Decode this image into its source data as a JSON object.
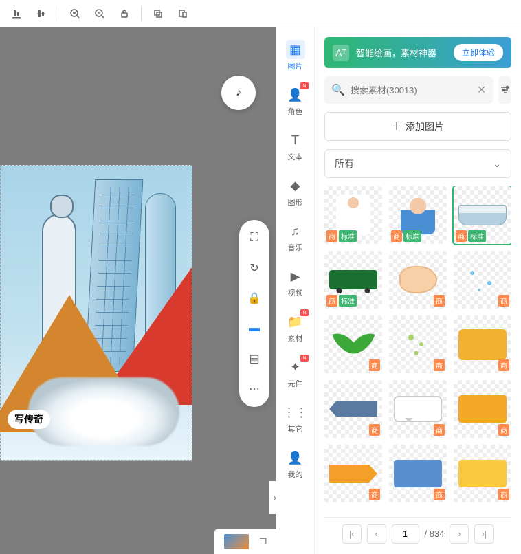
{
  "toolbar": {
    "items": [
      "align-bottom",
      "align-center-v",
      "zoom-in",
      "zoom-out",
      "unlock",
      "copy",
      "paste"
    ]
  },
  "canvas": {
    "text_label": "写传奇"
  },
  "sidebar": {
    "items": [
      {
        "key": "image",
        "label": "图片",
        "active": true,
        "badge": false
      },
      {
        "key": "role",
        "label": "角色",
        "active": false,
        "badge": true
      },
      {
        "key": "text",
        "label": "文本",
        "active": false,
        "badge": false
      },
      {
        "key": "shape",
        "label": "图形",
        "active": false,
        "badge": false
      },
      {
        "key": "music",
        "label": "音乐",
        "active": false,
        "badge": false
      },
      {
        "key": "video",
        "label": "视频",
        "active": false,
        "badge": false
      },
      {
        "key": "assets",
        "label": "素材",
        "active": false,
        "badge": true
      },
      {
        "key": "component",
        "label": "元件",
        "active": false,
        "badge": true
      },
      {
        "key": "other",
        "label": "其它",
        "active": false,
        "badge": false
      },
      {
        "key": "mine",
        "label": "我的",
        "active": false,
        "badge": false
      }
    ]
  },
  "panel": {
    "promo_text": "智能绘画，素材神器",
    "promo_btn": "立即体验",
    "search_placeholder": "搜索素材(30013)",
    "add_label": "添加图片",
    "dropdown_value": "所有",
    "tags": {
      "shop": "商",
      "standard": "标准"
    },
    "assets": [
      {
        "kind": "doctor",
        "shop": true,
        "std": true,
        "tag_side": "left",
        "selected": false
      },
      {
        "kind": "person",
        "shop": true,
        "std": true,
        "tag_side": "left",
        "selected": false
      },
      {
        "kind": "ship",
        "shop": true,
        "std": true,
        "tag_side": "left",
        "selected": true
      },
      {
        "kind": "truck",
        "shop": true,
        "std": true,
        "tag_side": "left",
        "selected": false
      },
      {
        "kind": "chicken",
        "shop": true,
        "std": false,
        "tag_side": "right",
        "selected": false
      },
      {
        "kind": "dots",
        "shop": true,
        "std": false,
        "tag_side": "right",
        "selected": false
      },
      {
        "kind": "leaf",
        "shop": true,
        "std": false,
        "tag_side": "right",
        "selected": false
      },
      {
        "kind": "dots-g",
        "shop": true,
        "std": false,
        "tag_side": "right",
        "selected": false
      },
      {
        "kind": "rect-y",
        "shop": true,
        "std": false,
        "tag_side": "right",
        "selected": false
      },
      {
        "kind": "arrow-b",
        "shop": true,
        "std": false,
        "tag_side": "right",
        "selected": false
      },
      {
        "kind": "bubble",
        "shop": true,
        "std": false,
        "tag_side": "right",
        "selected": false
      },
      {
        "kind": "rect-y2",
        "shop": true,
        "std": false,
        "tag_side": "right",
        "selected": false
      },
      {
        "kind": "arrow-o",
        "shop": true,
        "std": false,
        "tag_side": "right",
        "selected": false
      },
      {
        "kind": "rect-b",
        "shop": true,
        "std": false,
        "tag_side": "right",
        "selected": false
      },
      {
        "kind": "rect-y3",
        "shop": true,
        "std": false,
        "tag_side": "right",
        "selected": false
      }
    ],
    "pager": {
      "current": "1",
      "total": "834"
    }
  },
  "icons": {
    "image": "▦",
    "role": "👤",
    "text": "T",
    "shape": "◆",
    "music": "♫",
    "video": "▶",
    "assets": "📁",
    "component": "✦",
    "other": "⋮⋮",
    "mine": "👤",
    "search": "🔍",
    "clear": "✕",
    "filter": "⚙",
    "plus": "＋",
    "chevron_down": "⌄",
    "first": "|‹",
    "prev": "‹",
    "next": "›",
    "last": "›|",
    "expand": "›",
    "window": "❐",
    "focus": "⛶",
    "rotate": "↻",
    "lock": "🔒",
    "screen": "▬",
    "layers": "▤",
    "more": "⋯",
    "note": "♪"
  }
}
